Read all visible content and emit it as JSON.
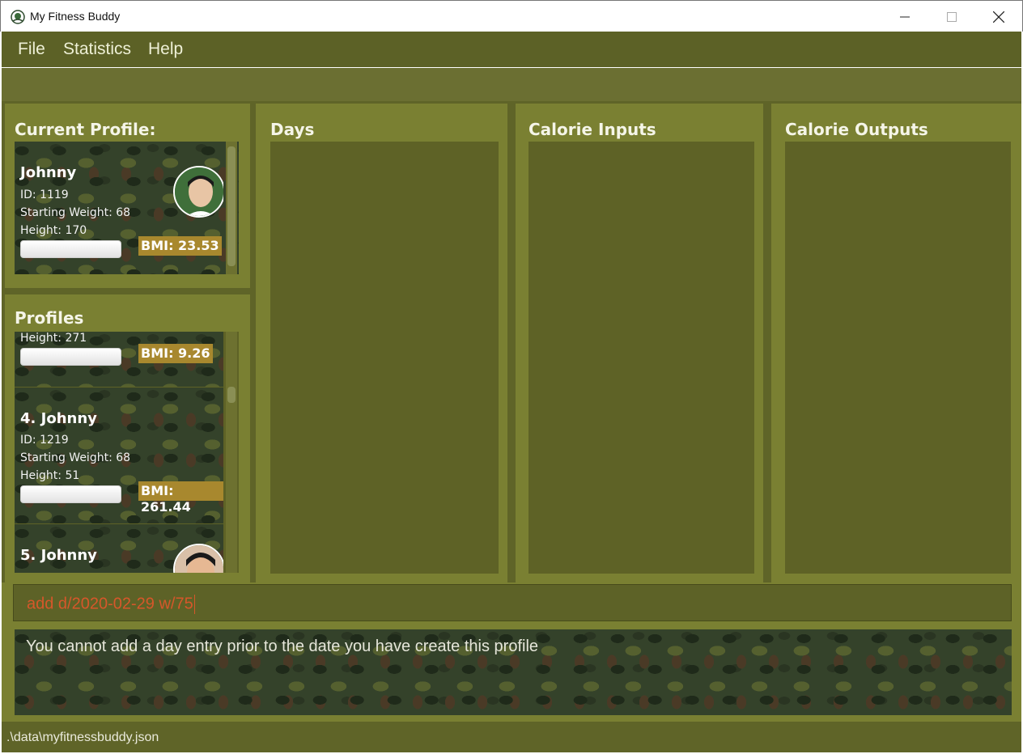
{
  "window": {
    "title": "My Fitness Buddy",
    "icon": "app-icon",
    "minimize_icon": "minimize-icon",
    "maximize_icon": "maximize-icon",
    "close_icon": "close-icon"
  },
  "menu": {
    "items": [
      "File",
      "Statistics",
      "Help"
    ]
  },
  "current_profile": {
    "title": "Current Profile:",
    "name": "Johnny",
    "id": "ID: 1119",
    "starting_weight": "Starting Weight: 68",
    "height": "Height: 170",
    "bmi": "BMI: 23.53"
  },
  "profiles": {
    "title": "Profiles",
    "items": [
      {
        "height": "Height: 271",
        "bmi": "BMI: 9.26"
      },
      {
        "name": "4.  Johnny",
        "id": "ID: 1219",
        "starting_weight": "Starting Weight: 68",
        "height": "Height: 51",
        "bmi": "BMI: 261.44"
      },
      {
        "name": "5.  Johnny"
      }
    ]
  },
  "panels": {
    "days": "Days",
    "calorie_inputs": "Calorie Inputs",
    "calorie_outputs": "Calorie Outputs"
  },
  "command": {
    "value": "add d/2020-02-29 w/75"
  },
  "result": {
    "message": "You cannot add a day entry prior to the date you have create this profile"
  },
  "status": {
    "path": ".\\data\\myfitnessbuddy.json"
  },
  "colors": {
    "menu_bg": "#5c6126",
    "panel_bg": "#7a8032",
    "list_bg": "#5e6226",
    "bmi_badge": "#a8882e",
    "command_text": "#d6572a"
  }
}
